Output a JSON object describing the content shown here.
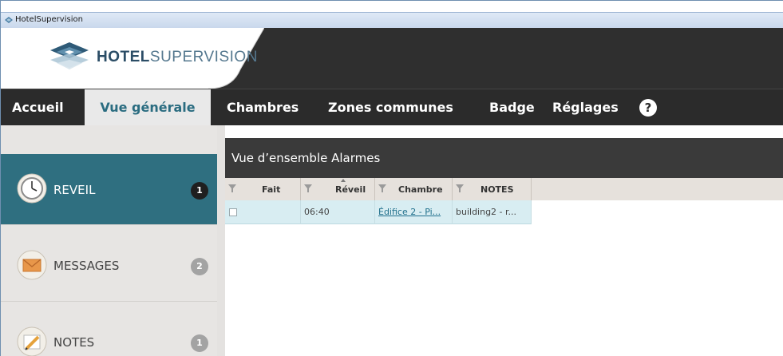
{
  "window": {
    "title": "HotelSupervision"
  },
  "logo": {
    "bold": "HOTEL",
    "light": "SUPERVISION"
  },
  "nav": {
    "items": [
      {
        "label": "Accueil"
      },
      {
        "label": "Vue générale"
      },
      {
        "label": "Chambres"
      },
      {
        "label": "Zones communes"
      },
      {
        "label": "Badge"
      },
      {
        "label": "Réglages"
      }
    ],
    "help": "?"
  },
  "sidebar": {
    "items": [
      {
        "label": "REVEIL",
        "count": "1",
        "icon": "clock-icon"
      },
      {
        "label": "MESSAGES",
        "count": "2",
        "icon": "envelope-icon"
      },
      {
        "label": "NOTES",
        "count": "1",
        "icon": "pencil-icon"
      }
    ]
  },
  "panel": {
    "title": "Vue d’ensemble Alarmes",
    "columns": [
      "Fait",
      "Réveil",
      "Chambre",
      "NOTES"
    ],
    "rows": [
      {
        "fait": "",
        "reveil": "06:40",
        "chambre": "Édifice 2 - Pi...",
        "notes": "building2 - r..."
      }
    ]
  },
  "colors": {
    "nav_bg": "#2b2b2b",
    "active_nav_text": "#2a6c80",
    "sidebar_active": "#2f6f80",
    "row_selected": "#d8edf2"
  }
}
